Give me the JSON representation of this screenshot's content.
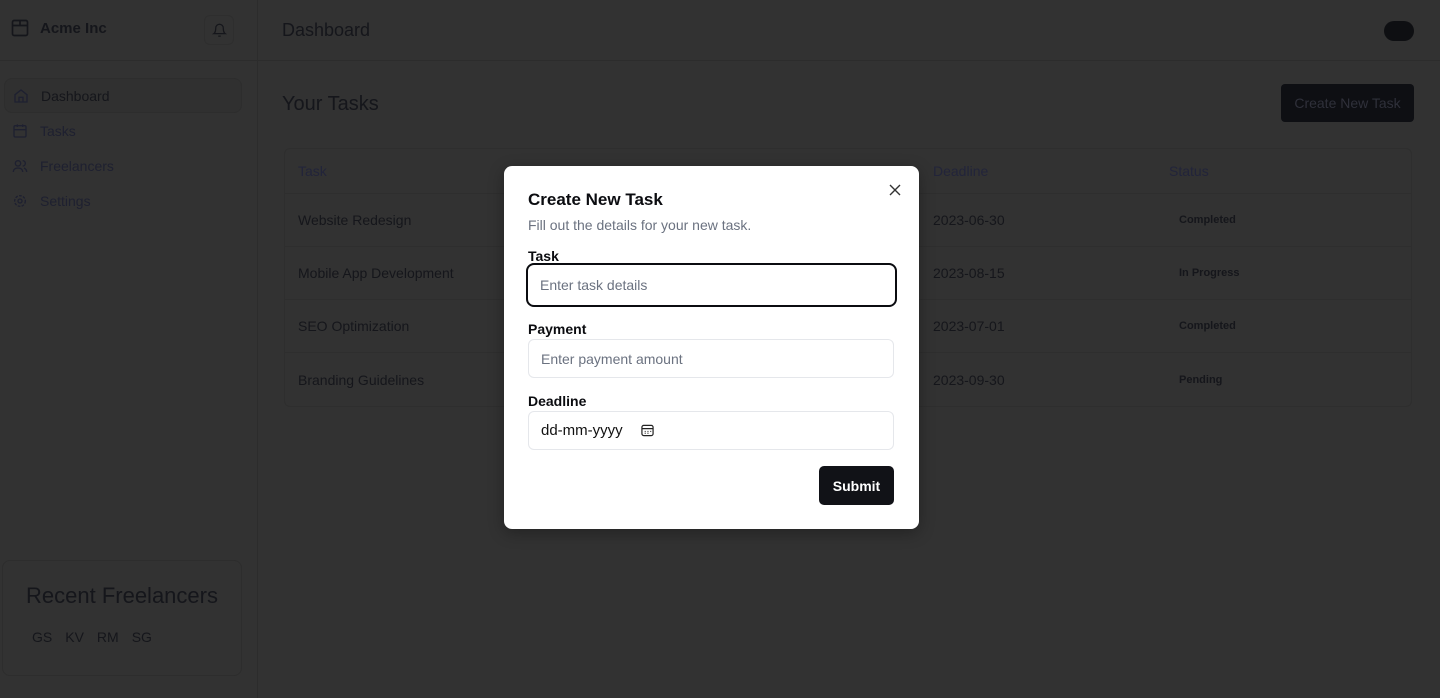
{
  "sidebar": {
    "brand": "Acme Inc",
    "nav": [
      {
        "label": "Dashboard",
        "icon": "home-icon",
        "active": true
      },
      {
        "label": "Tasks",
        "icon": "calendar-icon"
      },
      {
        "label": "Freelancers",
        "icon": "users-icon"
      },
      {
        "label": "Settings",
        "icon": "gear-icon"
      }
    ],
    "recent": {
      "title": "Recent Freelancers",
      "avatars": [
        "GS",
        "KV",
        "RM",
        "SG"
      ]
    }
  },
  "header": {
    "title": "Dashboard"
  },
  "main": {
    "title": "Your Tasks",
    "create_label": "Create New Task",
    "table": {
      "columns": [
        "Task",
        "",
        "Deadline",
        "Status"
      ],
      "rows": [
        [
          "Website Redesign",
          "",
          "2023-06-30",
          "Completed"
        ],
        [
          "Mobile App Development",
          "",
          "2023-08-15",
          "In Progress"
        ],
        [
          "SEO Optimization",
          "",
          "2023-07-01",
          "Completed"
        ],
        [
          "Branding Guidelines",
          "",
          "2023-09-30",
          "Pending"
        ]
      ]
    }
  },
  "modal": {
    "title": "Create New Task",
    "subtitle": "Fill out the details for your new task.",
    "task_label": "Task",
    "task_placeholder": "Enter task details",
    "payment_label": "Payment",
    "payment_placeholder": "Enter payment amount",
    "deadline_label": "Deadline",
    "deadline_placeholder": "dd-mm-yyyy",
    "submit_label": "Submit"
  }
}
